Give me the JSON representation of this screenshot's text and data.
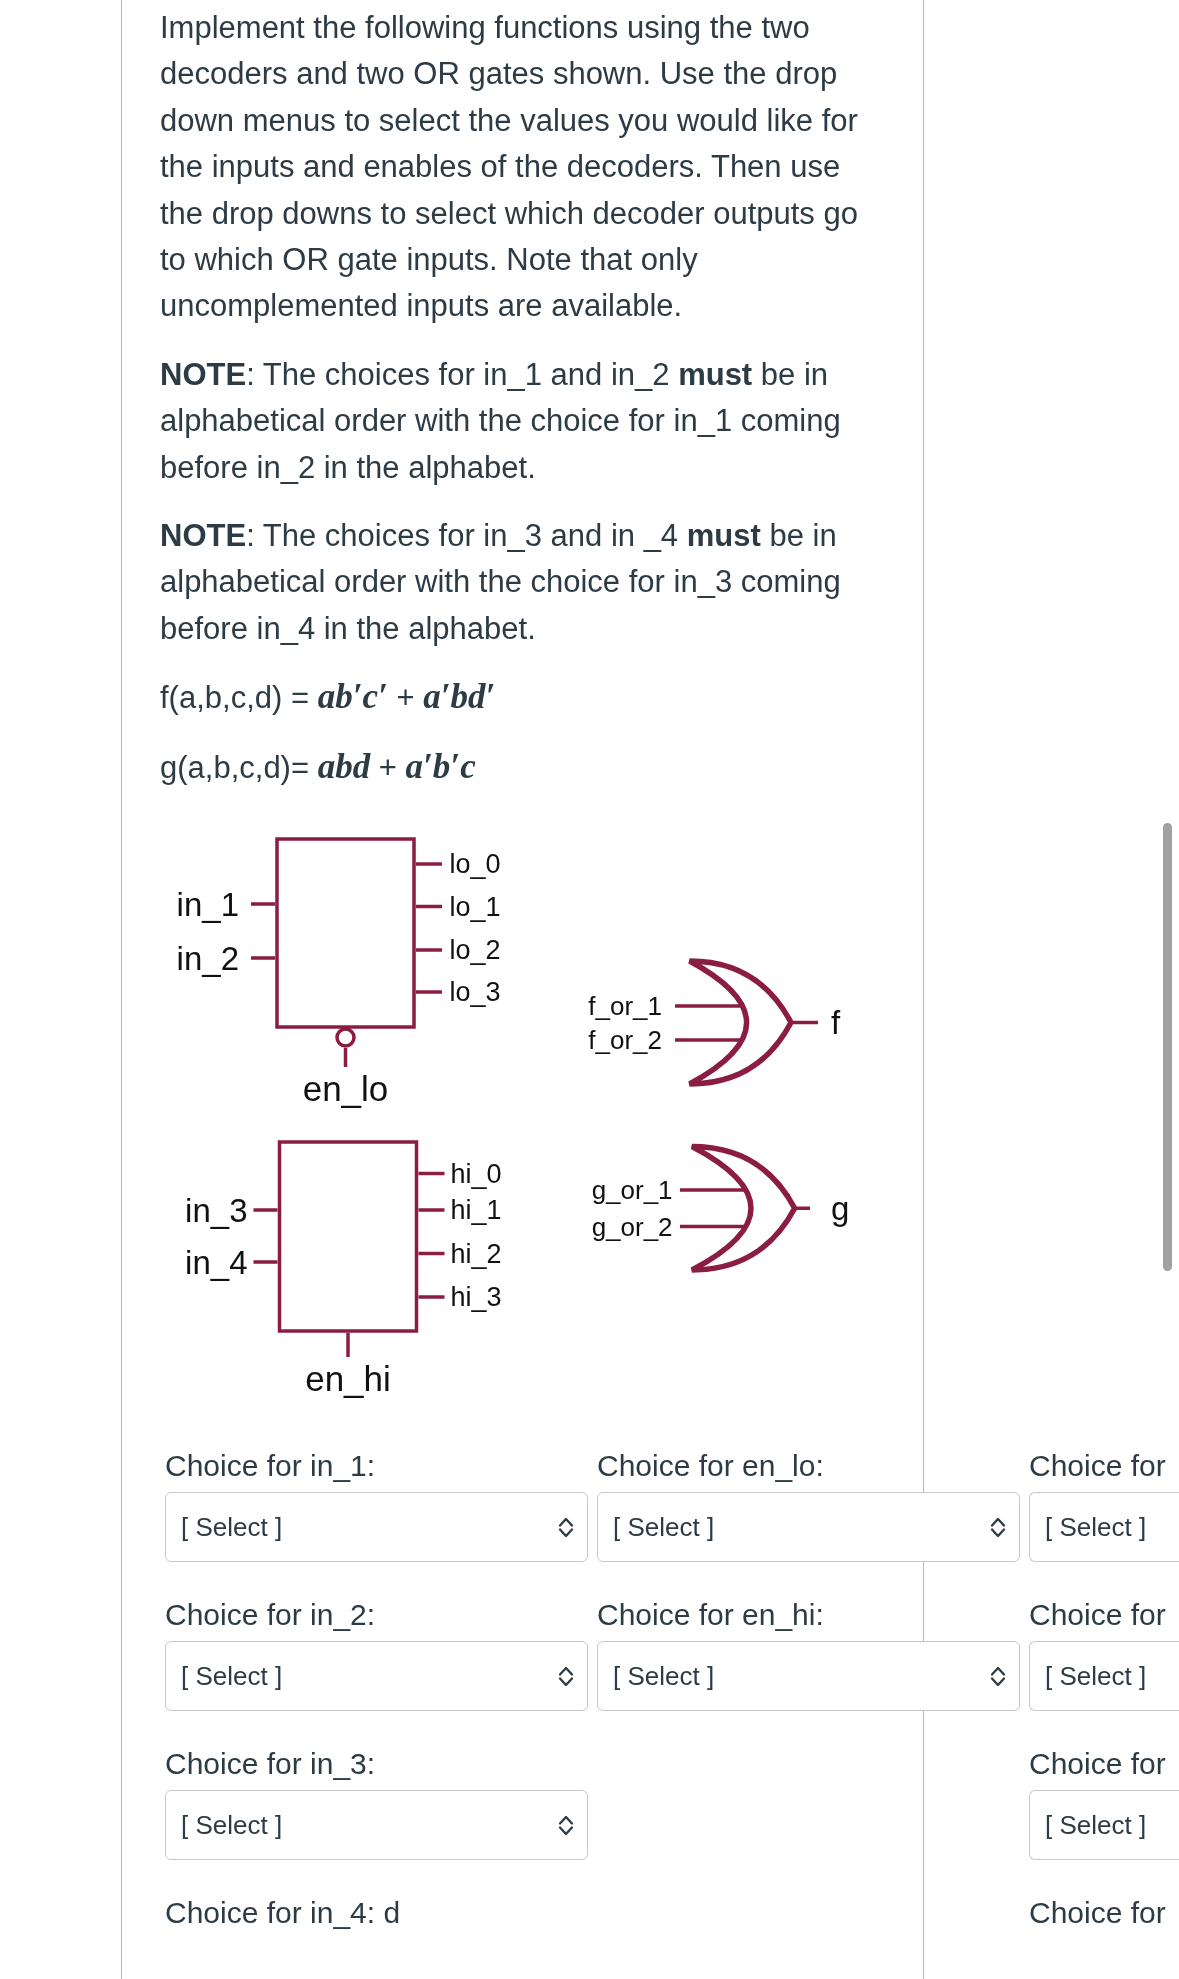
{
  "question": {
    "paragraphs": [
      "Implement the following functions using the two decoders and two OR gates shown. Use the drop down menus to select the values you would like for the inputs and enables of the decoders. Then use the drop downs to select which decoder outputs go to which OR gate inputs. Note that only uncomplemented inputs are available.",
      "**NOTE**: The choices for in_1 and in_2 **must** be in alphabetical order with the choice for in_1 coming before in_2 in the alphabet.",
      "**NOTE**: The choices for in_3 and in _4 **must** be in alphabetical order with the choice for in_3 coming before in_4 in the alphabet."
    ],
    "equations": [
      "f(a,b,c,d) = *ab′c′* + *a′bd′*",
      "g(a,b,c,d)= *abd* + *a′b′c*"
    ]
  },
  "diagram": {
    "decoders": [
      {
        "inputs": [
          "in_1",
          "in_2"
        ],
        "outputs": [
          "lo_0",
          "lo_1",
          "lo_2",
          "lo_3"
        ],
        "enable": "en_lo",
        "enable_inverted": true
      },
      {
        "inputs": [
          "in_3",
          "in_4"
        ],
        "outputs": [
          "hi_0",
          "hi_1",
          "hi_2",
          "hi_3"
        ],
        "enable": "en_hi",
        "enable_inverted": false
      }
    ],
    "or_gates": [
      {
        "inputs": [
          "f_or_1",
          "f_or_2"
        ],
        "output": "f"
      },
      {
        "inputs": [
          "g_or_1",
          "g_or_2"
        ],
        "output": "g"
      }
    ]
  },
  "choices": {
    "columns": [
      {
        "items": [
          {
            "kind": "select",
            "label": "Choice for in_1:",
            "value": "[ Select ]"
          },
          {
            "kind": "select",
            "label": "Choice for in_2:",
            "value": "[ Select ]"
          },
          {
            "kind": "select",
            "label": "Choice for in_3:",
            "value": "[ Select ]"
          },
          {
            "kind": "text",
            "label": "Choice for in_4: d"
          }
        ]
      },
      {
        "items": [
          {
            "kind": "select",
            "label": "Choice for en_lo:",
            "value": "[ Select ]"
          },
          {
            "kind": "select",
            "label": "Choice for en_hi:",
            "value": "[ Select ]"
          }
        ]
      },
      {
        "items": [
          {
            "kind": "select",
            "label": "Choice for",
            "value": "[ Select ]"
          },
          {
            "kind": "select",
            "label": "Choice for",
            "value": "[ Select ]"
          },
          {
            "kind": "select",
            "label": "Choice for",
            "value": "[ Select ]"
          },
          {
            "kind": "text",
            "label": "Choice for"
          }
        ]
      }
    ]
  }
}
